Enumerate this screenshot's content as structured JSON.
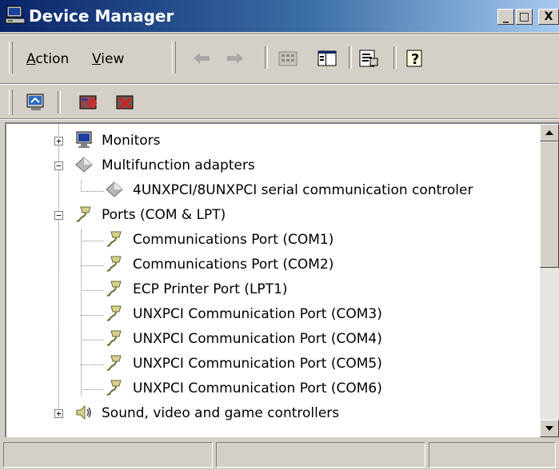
{
  "window": {
    "title": "Device Manager",
    "minimize_label": "_",
    "maximize_label": "□",
    "close_label": "X"
  },
  "menu": {
    "action": {
      "first": "A",
      "rest": "ction"
    },
    "view": {
      "first": "V",
      "rest": "iew"
    }
  },
  "toolbar": {
    "buttons": [
      "back-arrow",
      "forward-arrow",
      "up-folder",
      "show-hide-tree",
      "properties",
      "help"
    ]
  },
  "toolbar2": {
    "buttons": [
      "scan-hardware",
      "update-driver",
      "uninstall-device"
    ]
  },
  "tree": {
    "items": [
      {
        "label": "Monitors",
        "expander": "+"
      },
      {
        "label": "Multifunction adapters",
        "expander": "−"
      },
      {
        "label": "4UNXPCI/8UNXPCI serial communication controler"
      },
      {
        "label": "Ports (COM & LPT)",
        "expander": "−"
      },
      {
        "label": "Communications Port (COM1)"
      },
      {
        "label": "Communications Port (COM2)"
      },
      {
        "label": "ECP Printer Port (LPT1)"
      },
      {
        "label": "UNXPCI Communication Port (COM3)"
      },
      {
        "label": "UNXPCI Communication Port (COM4)"
      },
      {
        "label": "UNXPCI Communication Port (COM5)"
      },
      {
        "label": "UNXPCI Communication Port (COM6)"
      },
      {
        "label": "Sound, video and game controllers",
        "expander": "+"
      }
    ]
  },
  "scrollbar": {
    "up": "▲",
    "down": "▼"
  },
  "colors": {
    "title_start": "#0a246a",
    "title_end": "#a6caf0",
    "face": "#d4d0c8"
  }
}
